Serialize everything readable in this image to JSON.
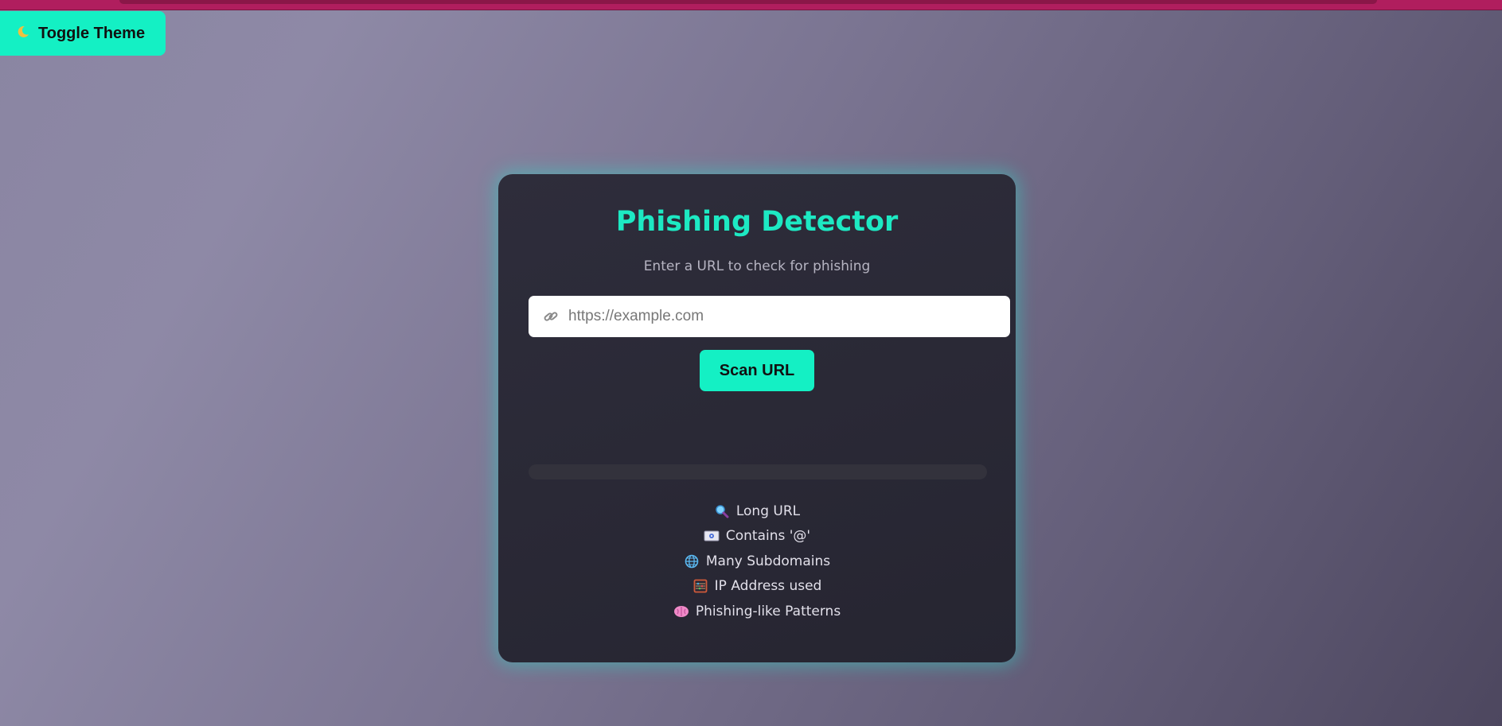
{
  "toggle": {
    "icon": "moon-icon",
    "label": "Toggle Theme"
  },
  "card": {
    "title": "Phishing Detector",
    "subtitle": "Enter a URL to check for phishing",
    "input": {
      "placeholder": "https://example.com",
      "value": "",
      "icon": "link-icon"
    },
    "scan_label": "Scan URL",
    "progress": 0,
    "features": [
      {
        "icon": "magnifier-icon",
        "label": "Long URL"
      },
      {
        "icon": "email-icon",
        "label": "Contains '@'"
      },
      {
        "icon": "globe-icon",
        "label": "Many Subdomains"
      },
      {
        "icon": "abacus-icon",
        "label": "IP Address used"
      },
      {
        "icon": "brain-icon",
        "label": "Phishing-like Patterns"
      }
    ]
  },
  "colors": {
    "accent": "#14f0c4",
    "title": "#1de9c3",
    "card_bg": "#2a2936",
    "top_strip": "#b01e5e"
  }
}
